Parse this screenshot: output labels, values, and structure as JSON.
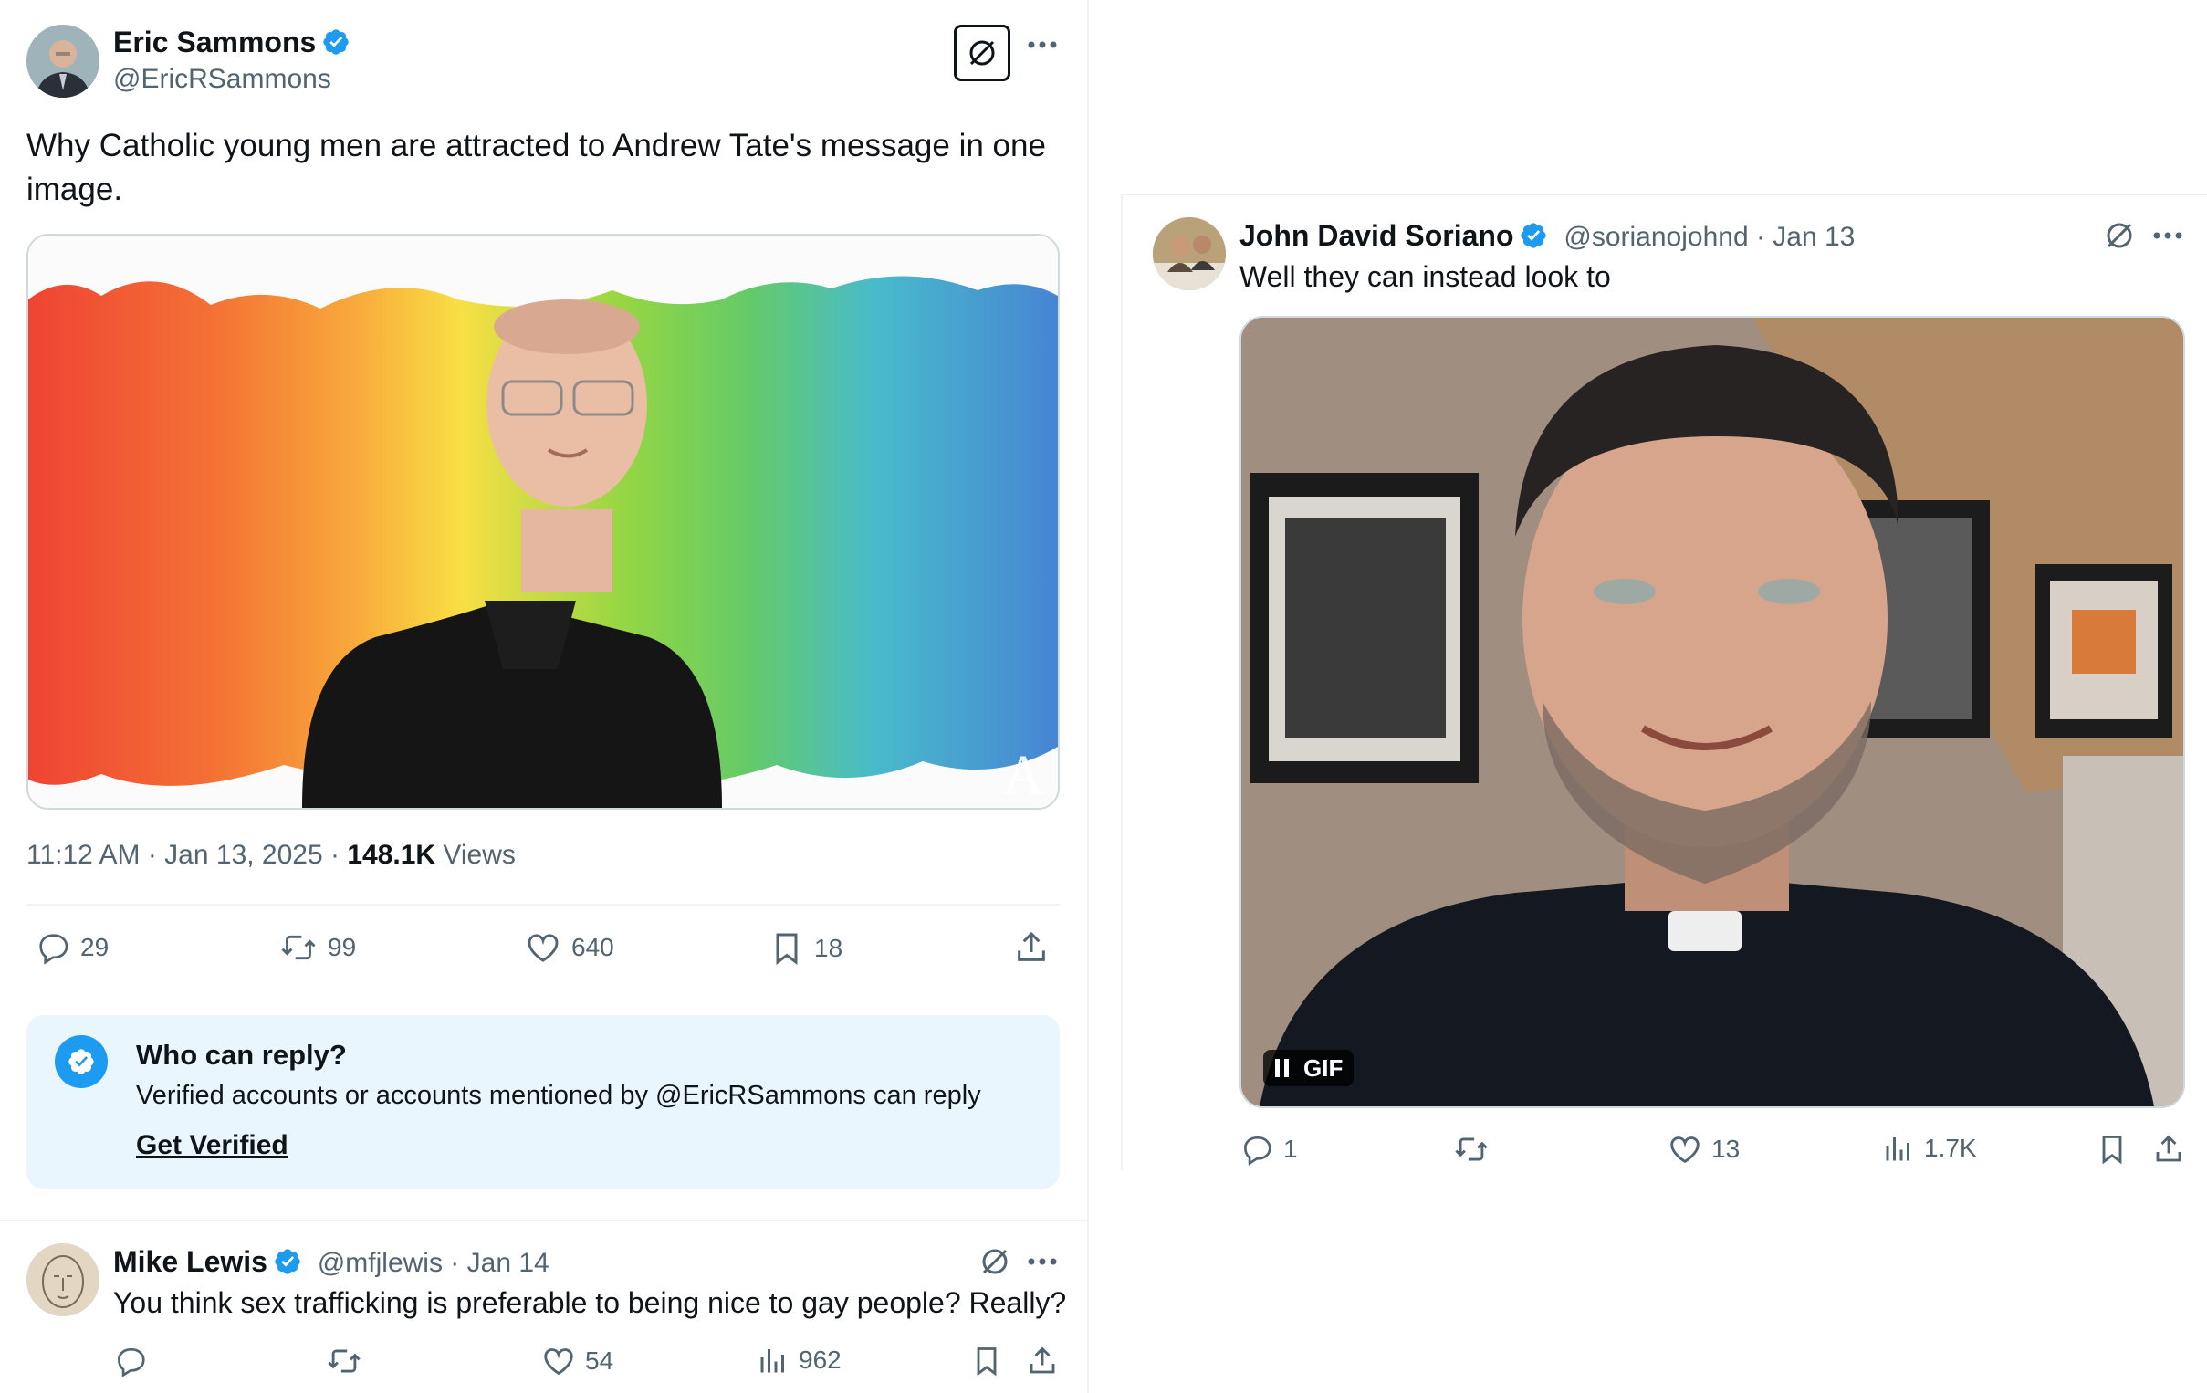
{
  "main_tweet": {
    "author_name": "Eric Sammons",
    "handle": "@EricRSammons",
    "text": "Why Catholic young men are attracted to Andrew Tate's message in one image.",
    "timestamp": "11:12 AM · Jan 13, 2025 · ",
    "views_count": "148.1K",
    "views_label": " Views",
    "actions": {
      "replies": "29",
      "reposts": "99",
      "likes": "640",
      "bookmarks": "18"
    },
    "image_watermark": "A"
  },
  "reply_restriction": {
    "title": "Who can reply?",
    "description": "Verified accounts or accounts mentioned by @EricRSammons can reply",
    "link": "Get Verified"
  },
  "reply_mike": {
    "author_name": "Mike Lewis",
    "handle_date": "@mfjlewis · Jan 14",
    "text": "You think sex trafficking is preferable to being nice to gay people? Really?",
    "actions": {
      "replies": "",
      "reposts": "",
      "likes": "54",
      "views": "962"
    }
  },
  "reply_john": {
    "author_name": "John David Soriano",
    "handle_date": "@sorianojohnd · Jan 13",
    "text": "Well they can instead look to",
    "gif_label": "GIF",
    "actions": {
      "replies": "1",
      "reposts": "",
      "likes": "13",
      "views": "1.7K"
    }
  },
  "colors": {
    "verified_blue": "#1d9bf0",
    "text": "#0f1419",
    "secondary": "#536471",
    "reply_box_bg": "#eaf6fd"
  }
}
